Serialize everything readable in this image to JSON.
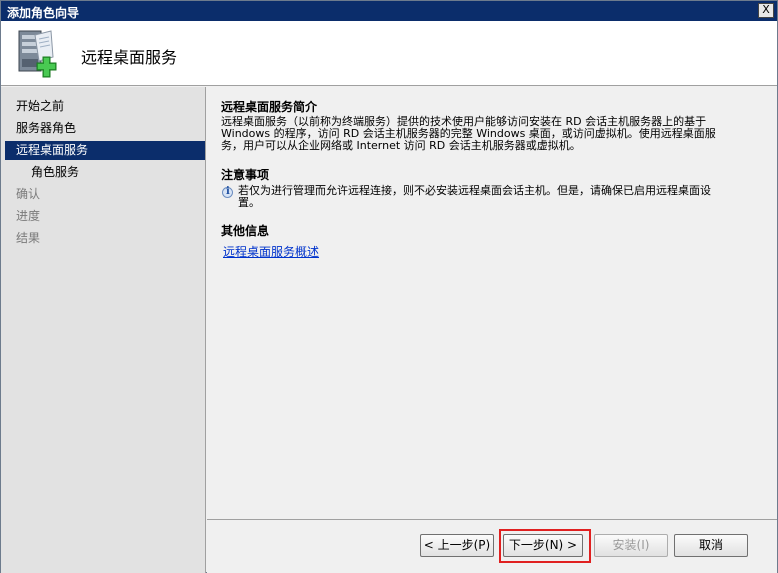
{
  "window": {
    "title": "添加角色向导",
    "close_label": "X"
  },
  "header": {
    "title": "远程桌面服务",
    "logo_icon": "server-plus-icon"
  },
  "sidebar": {
    "items": [
      {
        "label": "开始之前",
        "state": "normal"
      },
      {
        "label": "服务器角色",
        "state": "normal"
      },
      {
        "label": "远程桌面服务",
        "state": "active"
      },
      {
        "label": "角色服务",
        "state": "sub"
      },
      {
        "label": "确认",
        "state": "disabled"
      },
      {
        "label": "进度",
        "state": "disabled"
      },
      {
        "label": "结果",
        "state": "disabled"
      }
    ]
  },
  "content": {
    "intro_title": "远程桌面服务简介",
    "intro_line1": "远程桌面服务（以前称为终端服务）提供的技术使用户能够访问安装在 RD 会话主机服务器上的基于",
    "intro_line2": "Windows 的程序，访问 RD 会话主机服务器的完整 Windows 桌面，或访问虚拟机。使用远程桌面服",
    "intro_line3": "务，用户可以从企业网络或 Internet 访问 RD 会话主机服务器或虚拟机。",
    "notes_title": "注意事项",
    "note_icon": "info-icon",
    "note_line1": "若仅为进行管理而允许远程连接，则不必安装远程桌面会话主机。但是，请确保已启用远程桌面设",
    "note_line2": "置。",
    "more_title": "其他信息",
    "link_text": "远程桌面服务概述"
  },
  "footer": {
    "prev_label": "< 上一步(P)",
    "next_label": "下一步(N) >",
    "install_label": "安装(I)",
    "cancel_label": "取消"
  },
  "colors": {
    "titlebar": "#0b2d6b",
    "selected_nav": "#0b2d6b",
    "link": "#0033cc",
    "highlight": "#e02020"
  }
}
